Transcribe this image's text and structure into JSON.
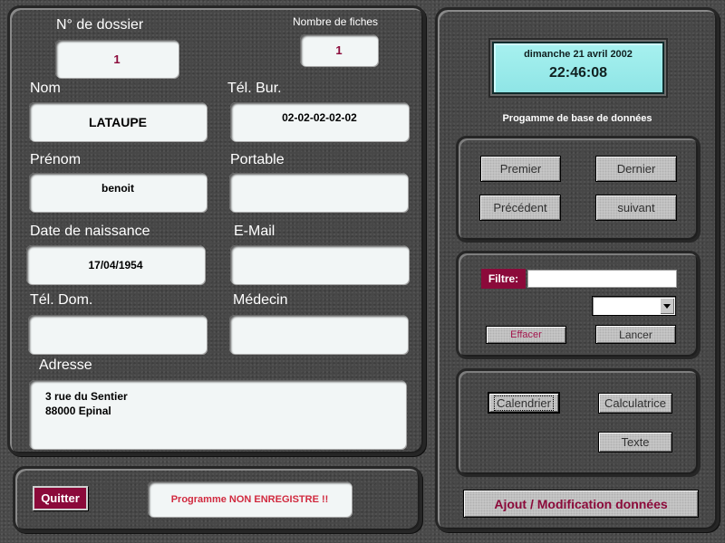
{
  "form": {
    "dossier_label": "N° de dossier",
    "dossier_value": "1",
    "fiches_label": "Nombre de fiches",
    "fiches_value": "1",
    "nom_label": "Nom",
    "nom_value": "LATAUPE",
    "telbur_label": "Tél. Bur.",
    "telbur_value": "02-02-02-02-02",
    "prenom_label": "Prénom",
    "prenom_value": "benoit",
    "portable_label": "Portable",
    "portable_value": "",
    "naissance_label": "Date de naissance",
    "naissance_value": "17/04/1954",
    "email_label": "E-Mail",
    "email_value": "",
    "teldom_label": "Tél. Dom.",
    "teldom_value": "",
    "medecin_label": "Médecin",
    "medecin_value": "",
    "adresse_label": "Adresse",
    "adresse_value": "3 rue du Sentier\n88000 Epinal"
  },
  "bottom": {
    "quit_label": "Quitter",
    "status_text": "Programme NON ENREGISTRE !!"
  },
  "clock": {
    "date": "dimanche 21 avril 2002",
    "time": "22:46:08"
  },
  "program_title": "Progamme de base de données",
  "nav": {
    "first": "Premier",
    "last": "Dernier",
    "previous": "Précédent",
    "next": "suivant"
  },
  "filter": {
    "label": "Filtre:",
    "value": "",
    "selected_option": "",
    "clear": "Effacer",
    "run": "Lancer"
  },
  "tools": {
    "calendar": "Calendrier",
    "calculator": "Calculatrice",
    "text": "Texte"
  },
  "add_modify": "Ajout / Modification  données",
  "colors": {
    "accent": "#8b0a3a",
    "clock_bg": "#a7f1ef",
    "panel": "#474747"
  }
}
